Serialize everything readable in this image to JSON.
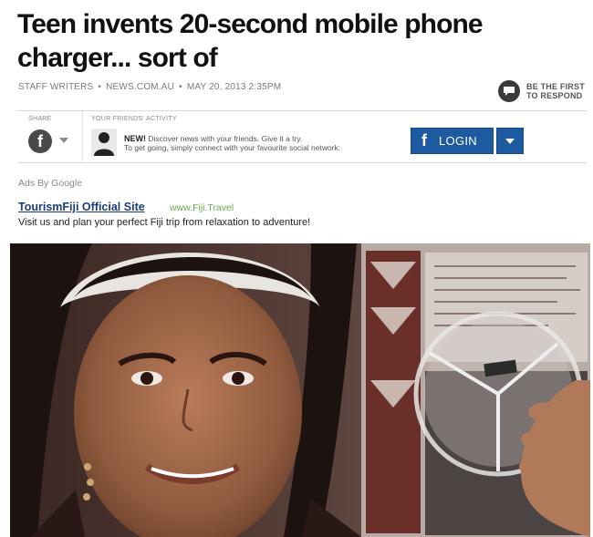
{
  "article": {
    "headline": "Teen invents 20-second mobile phone charger... sort of",
    "byline": {
      "author": "STAFF WRITERS",
      "source": "NEWS.COM.AU",
      "date": "MAY 20, 2013 2:35PM",
      "separator": "•"
    },
    "respond": {
      "line1": "BE THE FIRST",
      "line2": "TO RESPOND",
      "icon": "comment-bubble-icon"
    }
  },
  "share_bar": {
    "share_label": "SHARE",
    "share_icon": "facebook-icon",
    "friends_label": "YOUR FRIENDS' ACTIVITY",
    "new_label": "NEW!",
    "line1_rest": "Discover news with your friends. Give it a try.",
    "line2": "To get going, simply connect with your favourite social network:",
    "login_label": "LOGIN",
    "login_icon": "facebook-f-icon",
    "dropdown_icon": "caret-down-icon",
    "login_color": "#1d5aa0"
  },
  "ads": {
    "label": "Ads By Google",
    "title": "TourismFiji Official Site",
    "url": "www.Fiji.Travel",
    "description": "Visit us and plan your perfect Fiji trip from relaxation to adventure!"
  }
}
